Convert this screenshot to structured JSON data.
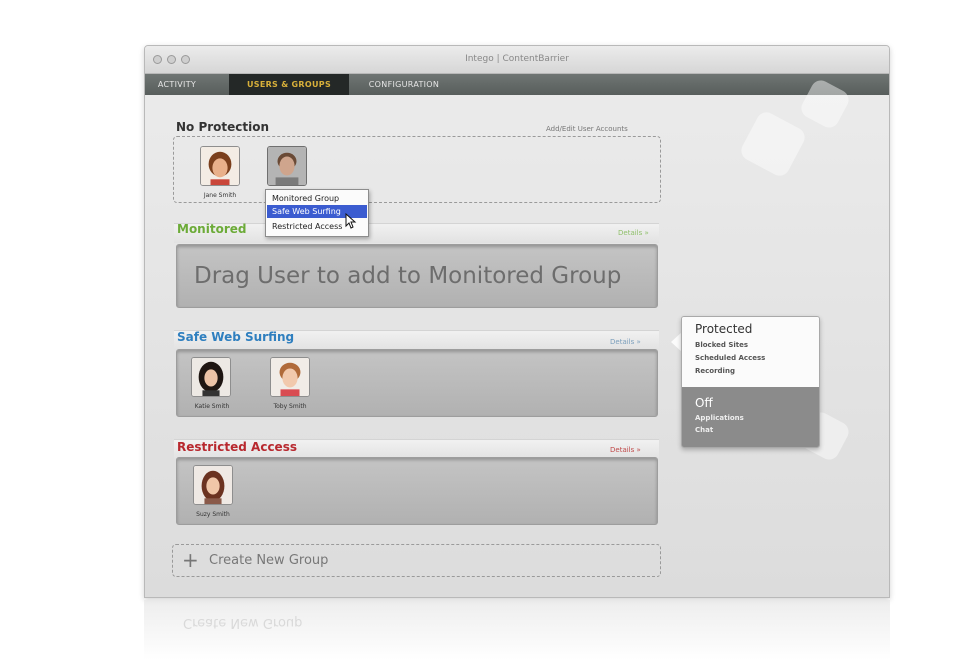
{
  "window": {
    "title": "Intego | ContentBarrier"
  },
  "tabs": [
    {
      "label": "ACTIVITY"
    },
    {
      "label": "USERS & GROUPS"
    },
    {
      "label": "CONFIGURATION"
    }
  ],
  "no_protection": {
    "title": "No Protection",
    "link": "Add/Edit User Accounts",
    "users": [
      {
        "name": "Jane Smith"
      }
    ]
  },
  "context_menu": {
    "items": [
      {
        "label": "Monitored Group"
      },
      {
        "label": "Safe Web Surfing"
      },
      {
        "label": "Restricted Access"
      }
    ],
    "highlighted_index": 1
  },
  "groups": [
    {
      "title": "Monitored",
      "details": "Details »",
      "placeholder": "Drag User to add to Monitored Group",
      "color": "#6cab38"
    },
    {
      "title": "Safe Web Surfing",
      "details": "Details »",
      "users": [
        {
          "name": "Katie Smith"
        },
        {
          "name": "Toby Smith"
        }
      ],
      "color": "#2f7fbf"
    },
    {
      "title": "Restricted Access",
      "details": "Details »",
      "users": [
        {
          "name": "Suzy Smith"
        }
      ],
      "color": "#b8282e"
    }
  ],
  "create_group": {
    "label": "Create New Group"
  },
  "popover": {
    "protected": {
      "title": "Protected",
      "items": [
        "Blocked Sites",
        "Scheduled Access",
        "Recording"
      ]
    },
    "off": {
      "title": "Off",
      "items": [
        "Applications",
        "Chat"
      ]
    }
  },
  "colors": {
    "tab_active_text": "#d8b03a",
    "menu_highlight": "#3b5cd0"
  }
}
